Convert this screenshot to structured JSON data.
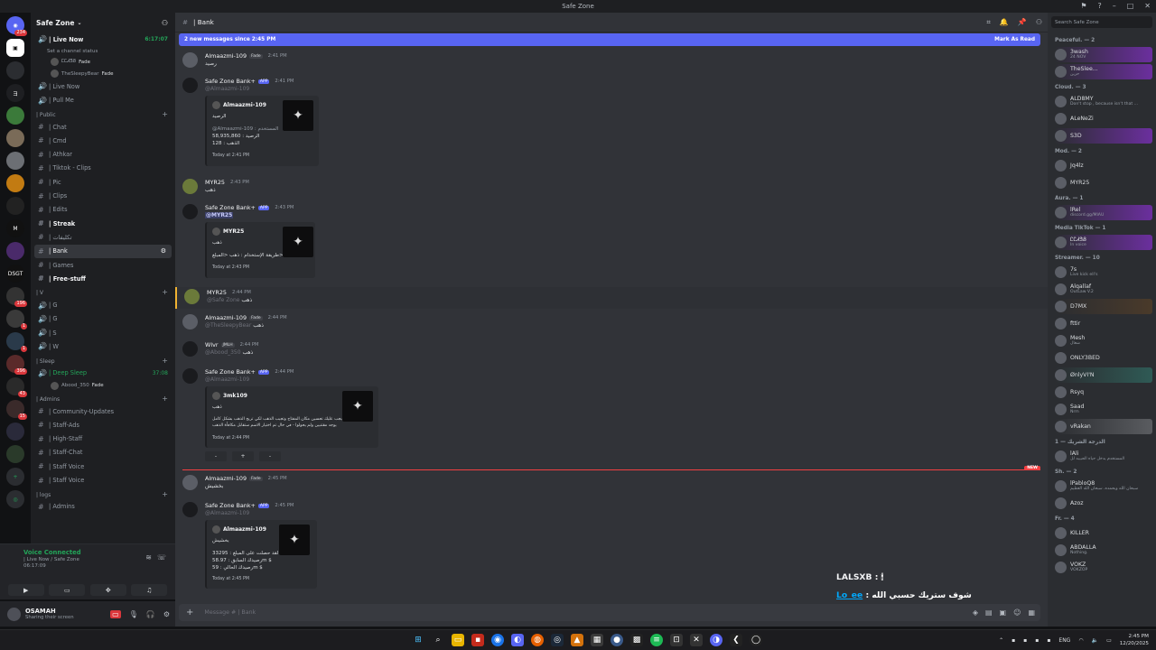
{
  "window": {
    "title": "Safe Zone"
  },
  "server": {
    "name": "Safe Zone"
  },
  "rail": {
    "badges": [
      "234",
      "196",
      "1",
      "1",
      "396",
      "43",
      "15"
    ]
  },
  "sidebar": {
    "live_now_top": "| Live Now",
    "channel_status": "Set a channel status",
    "live_timer": "6:17:07",
    "live_users": [
      "ᏝᏝᏗᏕᏰ",
      "TheSleepyBear"
    ],
    "fade_tag": "Fade",
    "channels_a": [
      "| Live Now",
      "| Pull Me"
    ],
    "cat_public": "| Public",
    "public_channels": [
      "| Chat",
      "| Cmd",
      "| Athkar",
      "| Tiktok - Clips",
      "| Pic",
      "| Clips",
      "| Edits",
      "| Streak",
      "| تكليفات",
      "| Bank",
      "| Games",
      "| Free-stuff"
    ],
    "cat_v": "| V",
    "voice_channels": [
      "| G",
      "| G",
      "| S",
      "| W"
    ],
    "cat_sleep": "| Sleep",
    "deep_sleep": "| Deep Sleep",
    "deep_timer": "37:08",
    "deep_user": "Abood_350",
    "cat_admins": "| Admins",
    "admin_channels": [
      "| Community-Updates",
      "| Staff-Ads",
      "| High-Staff",
      "| Staff-Chat",
      "| Staff Voice",
      "| Staff Voice"
    ],
    "cat_logs": "| logs",
    "logs_channels": [
      "| Admins"
    ]
  },
  "voice": {
    "status": "Voice Connected",
    "location": "| Live Now / Safe Zone",
    "timer": "06:17:09"
  },
  "user": {
    "name": "OSAMAH",
    "status": "Sharing their screen"
  },
  "chat": {
    "channel": "| Bank",
    "new_messages": "2 new messages since 2:45 PM",
    "mark_read": "Mark As Read",
    "messages": [
      {
        "author": "Almaazmi-109",
        "tag": "Fade",
        "time": "2:41 PM",
        "text": "رصيد"
      },
      {
        "author": "Safe Zone Bank+",
        "tag": "APP",
        "time": "2:41 PM",
        "reply": "@Almaazmi-109",
        "embed_title": "Almaazmi-109",
        "embed_sub": "الرصيد",
        "embed_lines": [
          "@Almaazmi-109 : المستخدم",
          "الرصيد : 58,935,860",
          "الذهب : 128"
        ],
        "embed_foot": "Today at 2:41 PM"
      },
      {
        "author": "MYR25",
        "time": "2:43 PM",
        "text": "ذهب"
      },
      {
        "author": "Safe Zone Bank+",
        "tag": "APP",
        "time": "2:43 PM",
        "reply": "@MYR25",
        "embed_title": "MYR25",
        "embed_sub": "ذهب",
        "embed_lines": [
          "طريقة الإستخدام : ذهب <المبلغ>"
        ],
        "embed_foot": "Today at 2:43 PM"
      },
      {
        "author": "MYR25",
        "time": "2:44 PM",
        "reply_grey": "@Safe Zone",
        "text": "ذهب"
      },
      {
        "author": "Almaazmi-109",
        "tag": "Fade",
        "time": "2:44 PM",
        "reply_grey": "@TheSleepyBear",
        "text": "ذهب"
      },
      {
        "author": "Wlvr",
        "tag": "JMLH",
        "time": "2:44 PM",
        "reply_grey": "@Abood_350",
        "text": "ذهب"
      },
      {
        "author": "Safe Zone Bank+",
        "tag": "APP",
        "time": "2:44 PM",
        "reply": "@Almaazmi-109",
        "embed_title": "3mk109",
        "embed_sub": "ذهب",
        "embed_lines": [
          "يجب عليك تحسين مكان المفتاح وتجيب الذهب لكي تربح الذهب بشكل كامل",
          "يوجد مقتنيين ولم يحولوا - في حال تم اختيار الاسم ستقابل مكافأة الذهب"
        ],
        "embed_foot": "Today at 2:44 PM"
      },
      {
        "author": "Almaazmi-109",
        "tag": "Fade",
        "time": "2:45 PM",
        "text": "بخشيش"
      },
      {
        "author": "Safe Zone Bank+",
        "tag": "APP",
        "time": "2:45 PM",
        "reply": "@Almaazmi-109",
        "embed_title": "Almaazmi-109",
        "embed_sub": "بخشيش",
        "embed_lines": [
          "لقد حصلت على المبلغ : 33295",
          "رصيدك السابق : 58.97m $",
          "رصيدك الحالي : 59m $"
        ],
        "embed_foot": "Today at 2:45 PM"
      }
    ],
    "buttons": [
      "-",
      "+",
      "-"
    ],
    "new_label": "NEW",
    "composer_placeholder": "Message # | Bank"
  },
  "overlay": {
    "line1_name": "LALSXB",
    "line1_text": ": 🕯",
    "line2_name": "Lo_ee",
    "line2_text": ": شوف ستريك حسبي الله"
  },
  "members": {
    "search": "Search Safe Zone",
    "groups": [
      {
        "label": "Peaceful. — 2",
        "items": [
          [
            "3wash",
            "24 NOV"
          ],
          [
            "TheSlee...",
            "حزين"
          ]
        ]
      },
      {
        "label": "Cloud. — 3",
        "items": [
          [
            "ALD8MY",
            "Don't stop , because isn't that ..."
          ],
          [
            "ALeNeZi",
            ""
          ],
          [
            "S3D",
            ""
          ]
        ]
      },
      {
        "label": "Mod. — 2",
        "items": [
          [
            "Jq4lz",
            ""
          ],
          [
            "MYR25",
            ""
          ]
        ]
      },
      {
        "label": "Aura. — 1",
        "items": [
          [
            "lRel",
            "discord.gg/MIAU"
          ]
        ]
      },
      {
        "label": "Media TikTok — 1",
        "items": [
          [
            "ᏝᏝᏗᏕᏰ",
            "In voice"
          ]
        ]
      },
      {
        "label": "Streamer. — 10",
        "items": [
          [
            "7s",
            "Live kick ell's"
          ],
          [
            "Alqallaf",
            "OutLaw V.2"
          ],
          [
            "D7MX",
            ""
          ],
          [
            "fttir",
            ""
          ],
          [
            "Mesh",
            "شغال"
          ],
          [
            "ONLY3BED",
            ""
          ],
          [
            "ØnlyVI'N",
            ""
          ],
          [
            "Rsyq",
            ""
          ],
          [
            "Saad",
            "Nrm"
          ],
          [
            "vRakan",
            ""
          ]
        ]
      },
      {
        "label": "الدرجة الشريك — 1",
        "items": [
          [
            "lAli",
            "المستخدم يدخل حياه الحبيبه لل"
          ]
        ]
      },
      {
        "label": "Sh. — 2",
        "items": [
          [
            "lPabloQ8",
            "سبحان الله وبحمده، سبحان الله العظيم"
          ],
          [
            "Azoz",
            ""
          ]
        ]
      },
      {
        "label": "Fr. — 4",
        "items": [
          [
            "KILLER",
            ""
          ],
          [
            "ABDALLA",
            "Nothing."
          ],
          [
            "VOKZ",
            "VOKZOP"
          ]
        ]
      }
    ]
  },
  "taskbar": {
    "lang": "ENG",
    "time": "2:45 PM",
    "date": "12/20/2025"
  }
}
